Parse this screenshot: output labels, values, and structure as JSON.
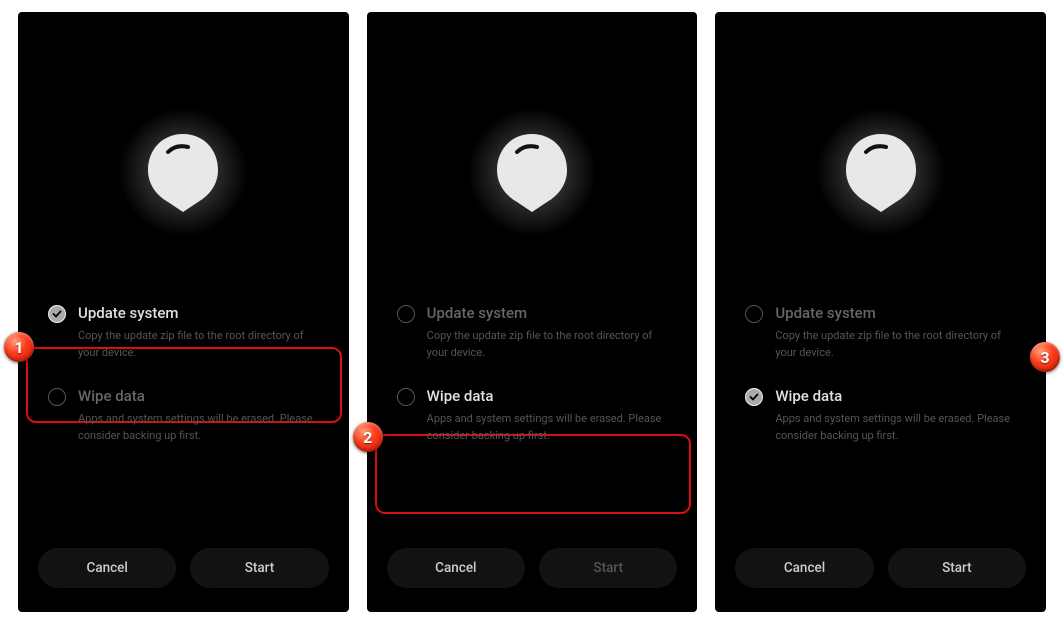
{
  "screens": [
    {
      "step_badge": "1",
      "highlight": "update",
      "opt_update": {
        "title": "Update system",
        "desc": "Copy the update zip file to the root directory of your device.",
        "checked": true
      },
      "opt_wipe": {
        "title": "Wipe data",
        "desc": "Apps and system settings will be erased. Please consider backing up first.",
        "checked": false
      },
      "cancel": "Cancel",
      "start": "Start",
      "start_dimmed": false
    },
    {
      "step_badge": "2",
      "highlight": "wipe",
      "opt_update": {
        "title": "Update system",
        "desc": "Copy the update zip file to the root directory of your device.",
        "checked": false
      },
      "opt_wipe": {
        "title": "Wipe data",
        "desc": "Apps and system settings will be erased. Please consider backing up first.",
        "checked": false
      },
      "cancel": "Cancel",
      "start": "Start",
      "start_dimmed": true
    },
    {
      "step_badge": "3",
      "highlight": "none",
      "opt_update": {
        "title": "Update system",
        "desc": "Copy the update zip file to the root directory of your device.",
        "checked": false
      },
      "opt_wipe": {
        "title": "Wipe data",
        "desc": "Apps and system settings will be erased. Please consider backing up first.",
        "checked": true
      },
      "cancel": "Cancel",
      "start": "Start",
      "start_dimmed": false
    }
  ]
}
